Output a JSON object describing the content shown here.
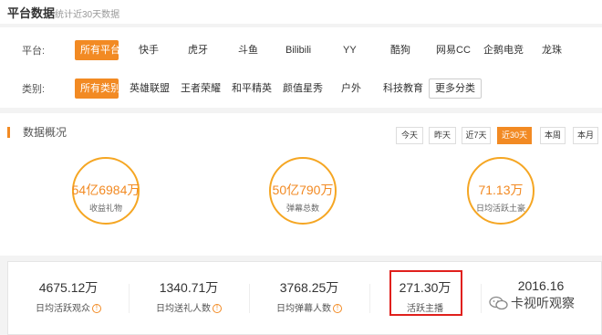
{
  "header": {
    "title": "平台数据",
    "subtitle": "统计近30天数据"
  },
  "filters": {
    "platform_label": "平台:",
    "platforms": [
      "所有平台",
      "快手",
      "虎牙",
      "斗鱼",
      "Bilibili",
      "YY",
      "酷狗",
      "网易CC",
      "企鹅电竞",
      "龙珠"
    ],
    "platform_selected": "所有平台",
    "category_label": "类别:",
    "categories": [
      "所有类别",
      "英雄联盟",
      "王者荣耀",
      "和平精英",
      "颜值星秀",
      "户外",
      "科技教育",
      "更多分类"
    ],
    "category_selected": "所有类别"
  },
  "overview": {
    "title": "数据概况",
    "time_buttons": [
      "今天",
      "昨天",
      "近7天",
      "近30天",
      "本周",
      "本月"
    ],
    "time_selected": "近30天",
    "circles": [
      {
        "value": "54亿6984万",
        "label": "收益礼物"
      },
      {
        "value": "50亿790万",
        "label": "弹幕总数"
      },
      {
        "value": "71.13万",
        "label": "日均活跃土豪"
      }
    ]
  },
  "stats": [
    {
      "value": "4675.12万",
      "label": "日均活跃观众",
      "info": true
    },
    {
      "value": "1340.71万",
      "label": "日均送礼人数",
      "info": true
    },
    {
      "value": "3768.25万",
      "label": "日均弹幕人数",
      "info": true
    },
    {
      "value": "271.30万",
      "label": "活跃主播",
      "info": false
    },
    {
      "value": "2016.16",
      "label": "",
      "info": false
    }
  ],
  "watermark": {
    "text": "卡视听观察"
  },
  "colors": {
    "accent": "#f28a23",
    "highlight": "#e0201c"
  }
}
